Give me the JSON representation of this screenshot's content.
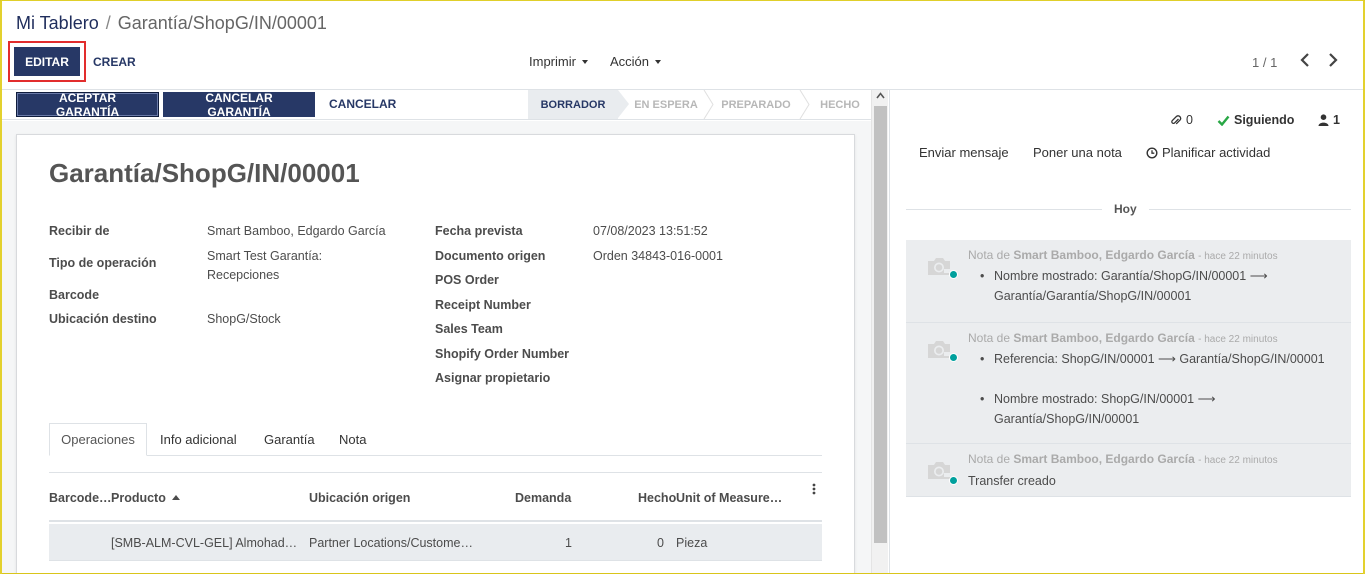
{
  "breadcrumb": {
    "parent": "Mi Tablero",
    "separator": "/",
    "current": "Garantía/ShopG/IN/00001"
  },
  "actions": {
    "edit": "EDITAR",
    "create": "CREAR",
    "print": "Imprimir",
    "action": "Acción"
  },
  "pager": {
    "value": "1 / 1"
  },
  "statusbar": {
    "accept_warranty": "ACEPTAR GARANTÍA",
    "cancel_warranty": "CANCELAR GARANTÍA",
    "cancel": "CANCELAR",
    "stages": [
      "BORRADOR",
      "EN ESPERA",
      "PREPARADO",
      "HECHO"
    ],
    "active_stage": "BORRADOR"
  },
  "form": {
    "title": "Garantía/ShopG/IN/00001",
    "left": {
      "recibir_de_label": "Recibir de",
      "recibir_de_value": "Smart Bamboo, Edgardo García",
      "tipo_operacion_label": "Tipo de operación",
      "tipo_operacion_value_1": "Smart Test Garantía:",
      "tipo_operacion_value_2": "Recepciones",
      "barcode_label": "Barcode",
      "ubicacion_destino_label": "Ubicación destino",
      "ubicacion_destino_value": "ShopG/Stock"
    },
    "right": {
      "fecha_prevista_label": "Fecha prevista",
      "fecha_prevista_value": "07/08/2023 13:51:52",
      "documento_origen_label": "Documento origen",
      "documento_origen_value": "Orden 34843-016-0001",
      "pos_order_label": "POS Order",
      "receipt_number_label": "Receipt Number",
      "sales_team_label": "Sales Team",
      "shopify_order_label": "Shopify Order Number",
      "asignar_propietario_label": "Asignar propietario"
    },
    "tabs": [
      "Operaciones",
      "Info adicional",
      "Garantía",
      "Nota"
    ],
    "table": {
      "headers": [
        "Barcode…",
        "Producto",
        "Ubicación origen",
        "Demanda",
        "Hecho",
        "Unit of Measure…"
      ],
      "rows": [
        {
          "barcode": "",
          "producto": "[SMB-ALM-CVL-GEL] Almohad…",
          "ubicacion": "Partner Locations/Custome…",
          "demanda": "1",
          "hecho": "0",
          "uom": "Pieza"
        }
      ]
    }
  },
  "chatter": {
    "attachments": "0",
    "following": "Siguiendo",
    "followers": "1",
    "send_message": "Enviar mensaje",
    "log_note": "Poner una nota",
    "schedule_activity": "Planificar actividad",
    "date_separator": "Hoy",
    "messages": [
      {
        "prefix": "Nota de",
        "author": "Smart Bamboo, Edgardo García",
        "time": "- hace 22 minutos",
        "items": [
          "Nombre mostrado: Garantía/ShopG/IN/00001 ⟶ Garantía/Garantía/ShopG/IN/00001"
        ]
      },
      {
        "prefix": "Nota de",
        "author": "Smart Bamboo, Edgardo García",
        "time": "- hace 22 minutos",
        "items": [
          "Referencia: ShopG/IN/00001 ⟶ Garantía/ShopG/IN/00001",
          "Nombre mostrado: ShopG/IN/00001 ⟶ Garantía/ShopG/IN/00001"
        ]
      },
      {
        "prefix": "Nota de",
        "author": "Smart Bamboo, Edgardo García",
        "time": "- hace 22 minutos",
        "text": "Transfer creado"
      }
    ]
  },
  "colors": {
    "primary": "#273866",
    "accent_teal": "#00a09d",
    "highlight_border": "#e22d2d"
  }
}
